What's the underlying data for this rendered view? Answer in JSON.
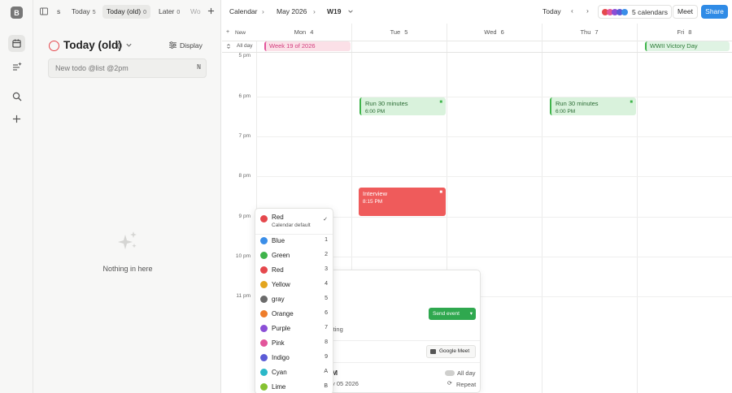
{
  "app": {
    "logo": "B"
  },
  "tabs": [
    {
      "label": "s",
      "count": ""
    },
    {
      "label": "Today",
      "count": "5"
    },
    {
      "label": "Today (old)",
      "count": "0"
    },
    {
      "label": "Later",
      "count": "0"
    },
    {
      "label": "Wo",
      "count": ""
    }
  ],
  "calendar_header": {
    "label": "Calendar",
    "month": "May 2026",
    "week": "W19",
    "today": "Today",
    "calendars": "5 calendars",
    "meet": "Meet",
    "share": "Share"
  },
  "panel": {
    "title": "Today (old)",
    "count": "0",
    "display": "Display",
    "new_todo_placeholder": "New todo @list @2pm",
    "kbd": "N",
    "empty": "Nothing in here"
  },
  "grid": {
    "new_label": "New",
    "all_day": "All day",
    "days": [
      {
        "name": "Mon",
        "num": "4"
      },
      {
        "name": "Tue",
        "num": "5"
      },
      {
        "name": "Wed",
        "num": "6"
      },
      {
        "name": "Thu",
        "num": "7"
      },
      {
        "name": "Fri",
        "num": "8"
      }
    ],
    "times": [
      "5 pm",
      "6 pm",
      "7 pm",
      "8 pm",
      "9 pm",
      "10 pm",
      "11 pm"
    ]
  },
  "events": {
    "week": "Week 19 of 2026",
    "wwii": "WWII Victory Day",
    "run1": {
      "title": "Run 30 minutes",
      "time": "6:00 PM"
    },
    "run2": {
      "title": "Run 30 minutes",
      "time": "6:00 PM"
    },
    "interview": {
      "title": "Interview",
      "time": "8:15 PM"
    }
  },
  "menu": {
    "header": {
      "label": "Red",
      "sub": "Calendar default",
      "color": "#e5484d"
    },
    "items": [
      {
        "label": "Blue",
        "key": "1",
        "color": "#3b8ee8"
      },
      {
        "label": "Green",
        "key": "2",
        "color": "#3fb44b"
      },
      {
        "label": "Red",
        "key": "3",
        "color": "#e5484d"
      },
      {
        "label": "Yellow",
        "key": "4",
        "color": "#e3a51e"
      },
      {
        "label": "gray",
        "key": "5",
        "color": "#6b6b6b"
      },
      {
        "label": "Orange",
        "key": "6",
        "color": "#ee7d2b"
      },
      {
        "label": "Purple",
        "key": "7",
        "color": "#8b4fd6"
      },
      {
        "label": "Pink",
        "key": "8",
        "color": "#e2559b"
      },
      {
        "label": "Indigo",
        "key": "9",
        "color": "#5b5bd6"
      },
      {
        "label": "Cyan",
        "key": "A",
        "color": "#2bb8c8"
      },
      {
        "label": "Lime",
        "key": "B",
        "color": "#86c232"
      }
    ]
  },
  "popover": {
    "send": "Send event",
    "iting": "iting",
    "meet": "Google Meet",
    "allday": "All day",
    "repeat": "Repeat",
    "m": "M",
    "date": "y 05 2026"
  },
  "colors": {
    "accent": "#2f8be6",
    "event_green": "#d9f2dc",
    "event_red": "#ef5b5b"
  }
}
